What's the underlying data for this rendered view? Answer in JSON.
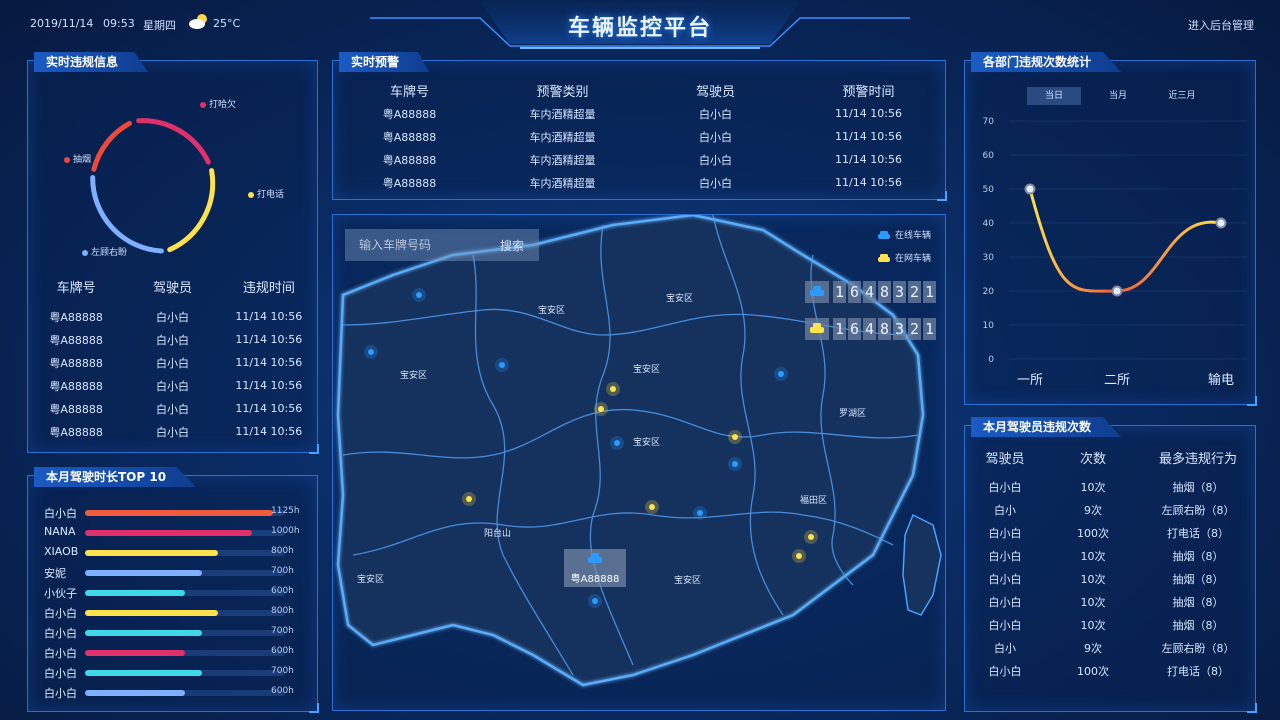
{
  "header": {
    "date": "2019/11/14",
    "time": "09:53",
    "weekday": "星期四",
    "weather_icon": "partly-cloudy-icon",
    "temperature": "25°C",
    "title": "车辆监控平台",
    "admin_link": "进入后台管理"
  },
  "colors": {
    "accent": "#2c6fd1",
    "glow": "#4aa2ff",
    "yellow": "#ffe14d",
    "blue_dot": "#2a9bff"
  },
  "violation_panel": {
    "title": "实时违规信息",
    "donut_labels": [
      {
        "text": "打哈欠",
        "color": "#e0306a"
      },
      {
        "text": "抽烟",
        "color": "#f0483a"
      },
      {
        "text": "打电话",
        "color": "#ffe14d"
      },
      {
        "text": "左顾右盼",
        "color": "#7fb0ff"
      }
    ],
    "headers": [
      "车牌号",
      "驾驶员",
      "违规时间"
    ],
    "rows": [
      [
        "粤A88888",
        "白小白",
        "11/14 10:56"
      ],
      [
        "粤A88888",
        "白小白",
        "11/14 10:56"
      ],
      [
        "粤A88888",
        "白小白",
        "11/14 10:56"
      ],
      [
        "粤A88888",
        "白小白",
        "11/14 10:56"
      ],
      [
        "粤A88888",
        "白小白",
        "11/14 10:56"
      ],
      [
        "粤A88888",
        "白小白",
        "11/14 10:56"
      ]
    ]
  },
  "top10_panel": {
    "title": "本月驾驶时长TOP 10",
    "items": [
      {
        "name": "白小白",
        "value": "1125h",
        "hours": 1125,
        "color": "#f05a3c"
      },
      {
        "name": "NANA",
        "value": "1000h",
        "hours": 1000,
        "color": "#e0306a"
      },
      {
        "name": "XIAOB",
        "value": "800h",
        "hours": 800,
        "color": "#ffe14d"
      },
      {
        "name": "安妮",
        "value": "700h",
        "hours": 700,
        "color": "#7fb0ff"
      },
      {
        "name": "小伙子",
        "value": "600h",
        "hours": 600,
        "color": "#3fd8e8"
      },
      {
        "name": "白小白",
        "value": "800h",
        "hours": 800,
        "color": "#ffe14d"
      },
      {
        "name": "白小白",
        "value": "700h",
        "hours": 700,
        "color": "#3fd8e8"
      },
      {
        "name": "白小白",
        "value": "600h",
        "hours": 600,
        "color": "#e0306a"
      },
      {
        "name": "白小白",
        "value": "700h",
        "hours": 700,
        "color": "#3fd8e8"
      },
      {
        "name": "白小白",
        "value": "600h",
        "hours": 600,
        "color": "#7fb0ff"
      }
    ]
  },
  "alert_panel": {
    "title": "实时预警",
    "headers": [
      "车牌号",
      "预警类别",
      "驾驶员",
      "预警时间"
    ],
    "rows": [
      [
        "粤A88888",
        "车内酒精超量",
        "白小白",
        "11/14 10:56"
      ],
      [
        "粤A88888",
        "车内酒精超量",
        "白小白",
        "11/14 10:56"
      ],
      [
        "粤A88888",
        "车内酒精超量",
        "白小白",
        "11/14 10:56"
      ],
      [
        "粤A88888",
        "车内酒精超量",
        "白小白",
        "11/14 10:56"
      ]
    ]
  },
  "map_panel": {
    "search_placeholder": "输入车牌号码",
    "search_button": "搜索",
    "legend_online": "在线车辆",
    "legend_network": "在网车辆",
    "online_count": [
      "1",
      "6",
      "4",
      "8",
      "3",
      "2",
      "1"
    ],
    "network_count": [
      "1",
      "6",
      "4",
      "8",
      "3",
      "2",
      "1"
    ],
    "regions": [
      "宝安区",
      "宝安区",
      "宝安区",
      "宝安区",
      "宝安区",
      "罗湖区",
      "福田区",
      "阳台山",
      "宝安区",
      "宝安区"
    ],
    "selected_car": "粤A88888"
  },
  "dept_panel": {
    "title": "各部门违规次数统计",
    "tabs": [
      "当日",
      "当月",
      "近三月"
    ],
    "chart_data": {
      "type": "line",
      "categories": [
        "一所",
        "二所",
        "输电"
      ],
      "values": [
        50,
        20,
        40
      ],
      "ylim": [
        0,
        70
      ],
      "yticks": [
        "0",
        "10",
        "20",
        "30",
        "40",
        "50",
        "60",
        "70"
      ],
      "grid": true
    }
  },
  "driver_panel": {
    "title": "本月驾驶员违规次数",
    "headers": [
      "驾驶员",
      "次数",
      "最多违规行为"
    ],
    "rows": [
      [
        "白小白",
        "10次",
        "抽烟（8）"
      ],
      [
        "白小",
        "9次",
        "左顾右盼（8）"
      ],
      [
        "白小白",
        "100次",
        "打电话（8）"
      ],
      [
        "白小白",
        "10次",
        "抽烟（8）"
      ],
      [
        "白小白",
        "10次",
        "抽烟（8）"
      ],
      [
        "白小白",
        "10次",
        "抽烟（8）"
      ],
      [
        "白小白",
        "10次",
        "抽烟（8）"
      ],
      [
        "白小",
        "9次",
        "左顾右盼（8）"
      ],
      [
        "白小白",
        "100次",
        "打电话（8）"
      ]
    ]
  }
}
